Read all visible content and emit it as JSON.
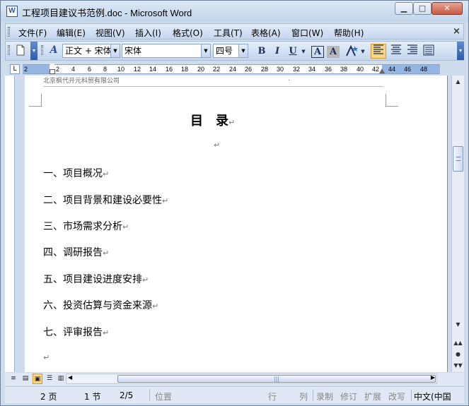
{
  "window": {
    "icon": "W",
    "title": "工程项目建议书范例.doc - Microsoft Word",
    "minimize": "▁",
    "maximize": "□",
    "close": "✕"
  },
  "menu": {
    "items": [
      "文件(F)",
      "编辑(E)",
      "视图(V)",
      "插入(I)",
      "格式(O)",
      "工具(T)",
      "表格(A)",
      "窗口(W)",
      "帮助(H)"
    ],
    "close_doc": "×"
  },
  "toolbar": {
    "style": "正文 + 宋体",
    "font": "宋体",
    "size": "四号",
    "bold": "B",
    "italic": "I",
    "underline": "U",
    "char_border": "A",
    "char_shading": "A"
  },
  "ruler": {
    "tab_selector": "L",
    "numbers": [
      "2",
      "2",
      "4",
      "6",
      "8",
      "10",
      "12",
      "14",
      "16",
      "18",
      "20",
      "22",
      "24",
      "26",
      "28",
      "30",
      "32",
      "34",
      "36",
      "38",
      "40",
      "42",
      "44",
      "46",
      "48"
    ]
  },
  "document": {
    "header": "北京枫代开元科贸有限公司",
    "header_mark": ".",
    "title": "目　录",
    "para_mark": "↵",
    "toc": [
      "一、项目概况",
      "二、项目背景和建设必要性",
      "三、市场需求分析",
      "四、调研报告",
      "五、项目建设进度安排",
      "六、投资估算与资金来源",
      "七、评审报告"
    ]
  },
  "hscroll": {
    "grip": "|||"
  },
  "status": {
    "page": "2 页",
    "section": "1 节",
    "page_of": "2/5",
    "position": "位置",
    "line": "行",
    "column": "列",
    "rec": "录制",
    "trk": "修订",
    "ext": "扩展",
    "ovr": "改写",
    "lang": "中文(中国"
  }
}
